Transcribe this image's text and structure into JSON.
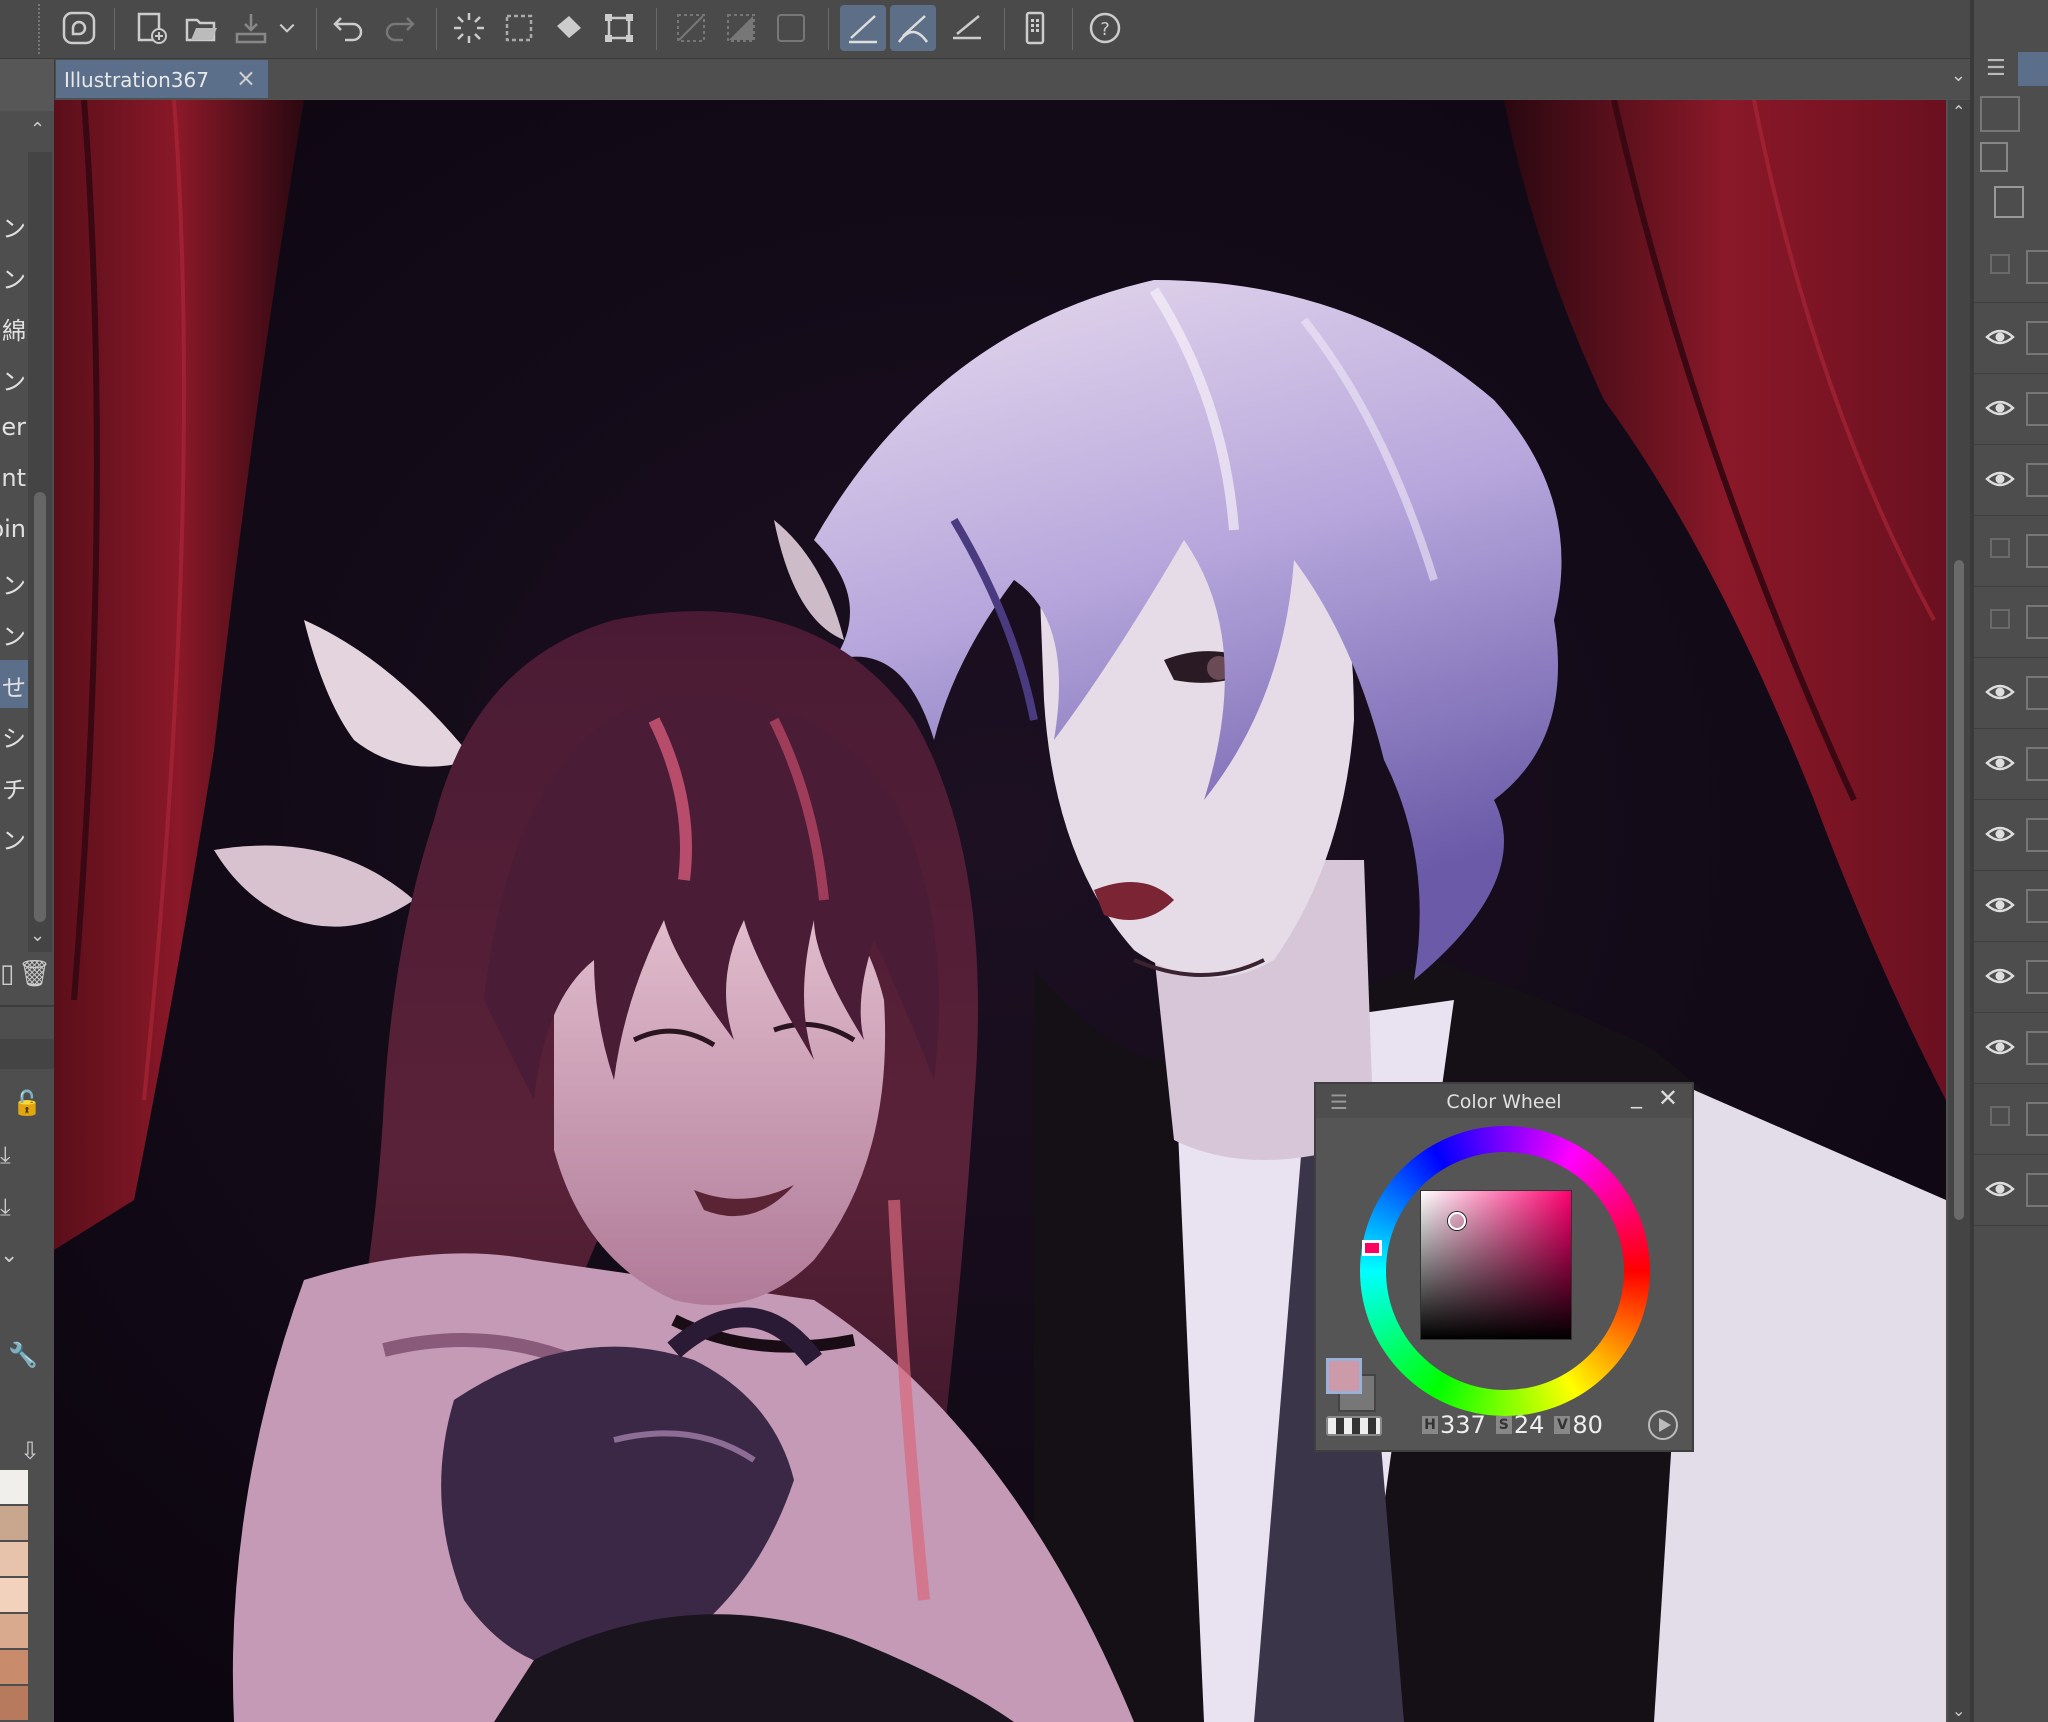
{
  "document": {
    "tab_title": "Illustration367",
    "tab_close": "×"
  },
  "brush_list": {
    "items": [
      "ン",
      "ン",
      "綿",
      "ン",
      "er",
      "nt",
      "oin",
      "ン",
      "ン",
      "せ",
      "シ",
      "チ",
      "ン"
    ],
    "selected_index": 9
  },
  "color_wheel": {
    "title": "Color Wheel",
    "menu_glyph": "☰",
    "minimize_glyph": "_",
    "close_glyph": "✕",
    "h_tag": "H",
    "h_value": "337",
    "s_tag": "S",
    "s_value": "24",
    "v_tag": "V",
    "v_value": "80",
    "main_color": "#cc9aa8"
  },
  "colors": {
    "accent_selected": "#5b6f8b",
    "toolbar_bg": "#4a4a4a",
    "panel_bg": "#4d4d4d"
  },
  "swatches": [
    "#f1efec",
    "#c9a78f",
    "#e7c3ab",
    "#f2d1bd",
    "#d9aa8e",
    "#c88c6c",
    "#b87a5c"
  ],
  "toolbar_icons": [
    "clip-studio-logo-icon",
    "new-canvas-icon",
    "open-folder-icon",
    "save-icon",
    "dropdown-chevron-icon",
    "undo-icon",
    "redo-icon",
    "clear-selection-icon",
    "select-all-icon",
    "fill-icon",
    "transform-icon",
    "selection-edit-icon",
    "selection-gradient-icon",
    "selection-border-icon",
    "snap-ruler-icon",
    "snap-special-ruler-icon",
    "snap-grid-icon",
    "smartphone-icon",
    "help-icon"
  ]
}
